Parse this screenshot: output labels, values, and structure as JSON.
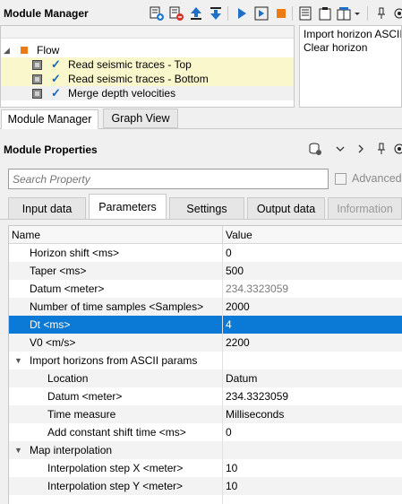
{
  "module_manager": {
    "title": "Module Manager",
    "tree": {
      "root_label": "Flow",
      "items": [
        {
          "label": "Read seismic traces - Top",
          "checked": true,
          "highlighted": true
        },
        {
          "label": "Read seismic traces - Bottom",
          "checked": true,
          "highlighted": true
        },
        {
          "label": "Merge depth velocities",
          "checked": true,
          "highlighted": false
        }
      ]
    },
    "side_list": [
      "Import horizon ASCII",
      "Clear horizon"
    ],
    "tabs": [
      "Module Manager",
      "Graph View"
    ],
    "toolbar_icons": [
      "add-module-icon",
      "remove-module-icon",
      "move-up-icon",
      "move-down-icon",
      "run-icon",
      "run-step-icon",
      "stop-icon",
      "log-icon",
      "clipboard-icon",
      "layout-icon",
      "dropdown-icon",
      "pin-icon",
      "more-icon"
    ]
  },
  "module_properties": {
    "title": "Module Properties",
    "search_placeholder": "Search Property",
    "advanced_label": "Advanced",
    "advanced_checked": false,
    "tabs": [
      {
        "label": "Input data",
        "active": false,
        "disabled": false
      },
      {
        "label": "Parameters",
        "active": true,
        "disabled": false
      },
      {
        "label": "Settings",
        "active": false,
        "disabled": false
      },
      {
        "label": "Output data",
        "active": false,
        "disabled": false
      },
      {
        "label": "Information",
        "active": false,
        "disabled": true
      }
    ],
    "grid": {
      "headers": {
        "name": "Name",
        "value": "Value"
      },
      "rows": [
        {
          "name": "Horizon shift <ms>",
          "value": "0",
          "level": 1
        },
        {
          "name": "Taper <ms>",
          "value": "500",
          "level": 1
        },
        {
          "name": "Datum <meter>",
          "value": "234.3323059",
          "level": 1,
          "dim": true
        },
        {
          "name": "Number of time samples <Samples>",
          "value": "2000",
          "level": 1
        },
        {
          "name": "Dt <ms>",
          "value": "4",
          "level": 1,
          "selected": true
        },
        {
          "name": "V0 <m/s>",
          "value": "2200",
          "level": 1
        },
        {
          "name": "Import horizons from ASCII params",
          "value": "",
          "level": 1,
          "group": true
        },
        {
          "name": "Location",
          "value": "Datum",
          "level": 2
        },
        {
          "name": "Datum <meter>",
          "value": "234.3323059",
          "level": 2
        },
        {
          "name": "Time measure",
          "value": "Milliseconds",
          "level": 2
        },
        {
          "name": "Add constant shift time <ms>",
          "value": "0",
          "level": 2
        },
        {
          "name": "Map interpolation",
          "value": "",
          "level": 1,
          "group": true
        },
        {
          "name": "Interpolation step X <meter>",
          "value": "10",
          "level": 2
        },
        {
          "name": "Interpolation step Y <meter>",
          "value": "10",
          "level": 2
        }
      ]
    }
  }
}
